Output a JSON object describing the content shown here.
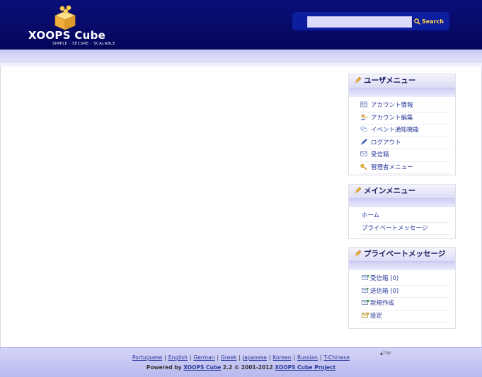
{
  "header": {
    "logo_text": "XOOPS Cube",
    "logo_tagline": "SIMPLE · SECURE · SCALABLE",
    "search_placeholder": "",
    "search_button": "Search"
  },
  "user_menu": {
    "title": "ユーザメニュー",
    "items": [
      {
        "label": "アカウント情報",
        "icon": "id-card-icon"
      },
      {
        "label": "アカウント編集",
        "icon": "user-edit-icon"
      },
      {
        "label": "イベント通知機能",
        "icon": "notification-icon"
      },
      {
        "label": "ログアウト",
        "icon": "logout-icon"
      },
      {
        "label": "受信箱",
        "icon": "mail-icon"
      },
      {
        "label": "管理者メニュー",
        "icon": "key-icon"
      }
    ]
  },
  "main_menu": {
    "title": "メインメニュー",
    "items": [
      {
        "label": "ホーム"
      },
      {
        "label": "プライベートメッセージ"
      }
    ]
  },
  "pm_menu": {
    "title": "プライベートメッセージ",
    "items": [
      {
        "label": "受信箱 (0)",
        "icon": "inbox-icon"
      },
      {
        "label": "送信箱 (0)",
        "icon": "outbox-icon"
      },
      {
        "label": "新規作成",
        "icon": "compose-icon"
      },
      {
        "label": "設定",
        "icon": "settings-icon"
      }
    ]
  },
  "footer": {
    "to_top": "▲TOP",
    "languages": [
      "Portuguese",
      "English",
      "German",
      "Greek",
      "Japanese",
      "Korean",
      "Russian",
      "T-Chinese"
    ],
    "powered_prefix": "Powered by",
    "powered_link": "XOOPS Cube",
    "powered_middle": "2.2 © 2001-2012",
    "project_link": "XOOPS Cube Project"
  },
  "colors": {
    "header_bg": "#0a0f7a",
    "link": "#2a3a98",
    "search_label": "#ffd84a"
  }
}
